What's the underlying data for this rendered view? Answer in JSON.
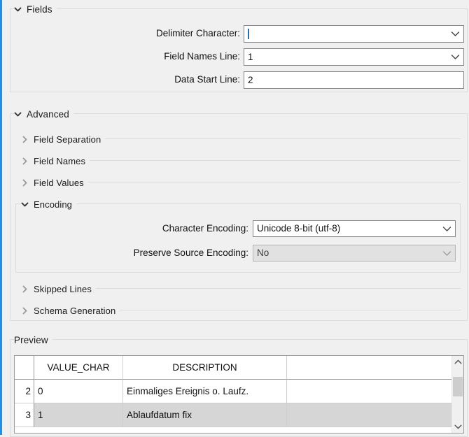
{
  "theme": {
    "accent_color": "#1e90e8",
    "background": "#f0f0f0",
    "field_border": "#868686",
    "disabled_field_bg": "#e1e1e1",
    "selected_row_bg": "#d6d6d6"
  },
  "sections": {
    "fields": {
      "title": "Fields",
      "expanded": true,
      "chevron": "chevron-down-icon",
      "rows": [
        {
          "label": "Delimiter Character:",
          "value": "|",
          "control": "combobox",
          "has_caret": true,
          "enabled": true
        },
        {
          "label": "Field Names Line:",
          "value": "1",
          "control": "combobox",
          "has_caret": false,
          "enabled": true
        },
        {
          "label": "Data Start Line:",
          "value": "2",
          "control": "textbox",
          "has_caret": false,
          "enabled": true
        }
      ]
    },
    "advanced": {
      "title": "Advanced",
      "expanded": true,
      "chevron": "chevron-down-icon",
      "subsections": [
        {
          "title": "Field Separation",
          "expanded": false,
          "chevron": "chevron-right-icon"
        },
        {
          "title": "Field Names",
          "expanded": false,
          "chevron": "chevron-right-icon"
        },
        {
          "title": "Field Values",
          "expanded": false,
          "chevron": "chevron-right-icon"
        },
        {
          "title": "Encoding",
          "expanded": true,
          "chevron": "chevron-down-icon"
        },
        {
          "title": "Skipped Lines",
          "expanded": false,
          "chevron": "chevron-right-icon"
        },
        {
          "title": "Schema Generation",
          "expanded": false,
          "chevron": "chevron-right-icon"
        }
      ],
      "encoding_rows": [
        {
          "label": "Character Encoding:",
          "value": "Unicode 8-bit (utf-8)",
          "control": "combobox",
          "enabled": true
        },
        {
          "label": "Preserve Source Encoding:",
          "value": "No",
          "control": "combobox",
          "enabled": false
        }
      ]
    },
    "preview": {
      "title": "Preview",
      "table": {
        "columns": [
          "",
          "VALUE_CHAR",
          "DESCRIPTION",
          ""
        ],
        "rows": [
          {
            "number": "2",
            "value_char": "0",
            "description": "Einmaliges Ereignis o. Laufz.",
            "blank": "",
            "selected": false
          },
          {
            "number": "3",
            "value_char": "1",
            "description": "Ablaufdatum fix",
            "blank": "",
            "selected": true
          }
        ],
        "scrollbar": {
          "up_icon": "chevron-up-icon",
          "down_icon": "chevron-down-icon",
          "thumb_position": "top"
        }
      }
    }
  }
}
